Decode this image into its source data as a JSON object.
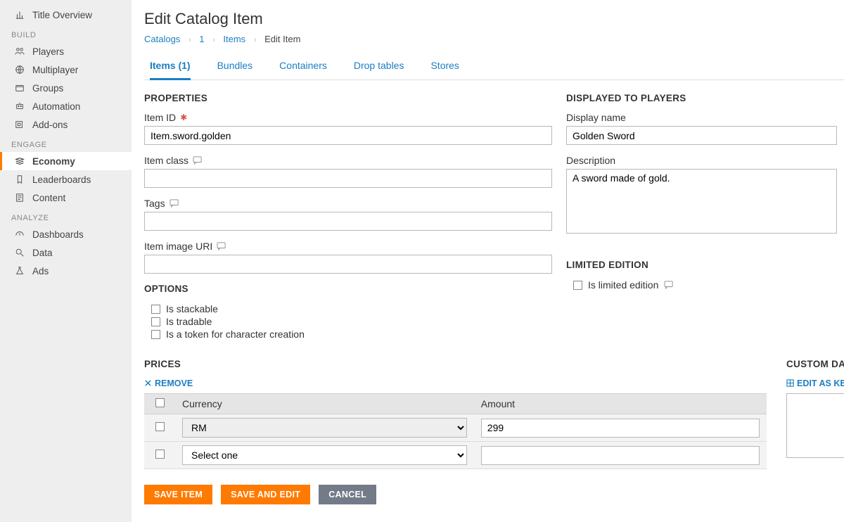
{
  "sidebar": {
    "top_item": "Title Overview",
    "sections": [
      {
        "label": "BUILD",
        "items": [
          "Players",
          "Multiplayer",
          "Groups",
          "Automation",
          "Add-ons"
        ]
      },
      {
        "label": "ENGAGE",
        "items": [
          "Economy",
          "Leaderboards",
          "Content"
        ],
        "active": 0
      },
      {
        "label": "ANALYZE",
        "items": [
          "Dashboards",
          "Data",
          "Ads"
        ]
      }
    ]
  },
  "page": {
    "title": "Edit Catalog Item",
    "breadcrumb": {
      "parts": [
        "Catalogs",
        "1",
        "Items"
      ],
      "current": "Edit Item"
    },
    "tabs": [
      "Items (1)",
      "Bundles",
      "Containers",
      "Drop tables",
      "Stores"
    ],
    "active_tab": 0
  },
  "properties": {
    "header": "PROPERTIES",
    "item_id_label": "Item ID",
    "item_id_value": "Item.sword.golden",
    "item_class_label": "Item class",
    "item_class_value": "",
    "tags_label": "Tags",
    "tags_value": "",
    "image_uri_label": "Item image URI",
    "image_uri_value": ""
  },
  "displayed": {
    "header": "DISPLAYED TO PLAYERS",
    "display_name_label": "Display name",
    "display_name_value": "Golden Sword",
    "description_label": "Description",
    "description_value": "A sword made of gold."
  },
  "options": {
    "header": "OPTIONS",
    "items": [
      "Is stackable",
      "Is tradable",
      "Is a token for character creation"
    ]
  },
  "limited": {
    "header": "LIMITED EDITION",
    "label": "Is limited edition"
  },
  "prices": {
    "header": "PRICES",
    "remove": "REMOVE",
    "cols": {
      "currency": "Currency",
      "amount": "Amount"
    },
    "rows": [
      {
        "currency": "RM",
        "amount": "299"
      },
      {
        "currency": "Select one",
        "amount": ""
      }
    ]
  },
  "custom": {
    "header": "CUSTOM DATA",
    "edit_link": "EDIT AS KEY/VA"
  },
  "buttons": {
    "save_item": "SAVE ITEM",
    "save_edit": "SAVE AND EDIT",
    "cancel": "CANCEL"
  }
}
